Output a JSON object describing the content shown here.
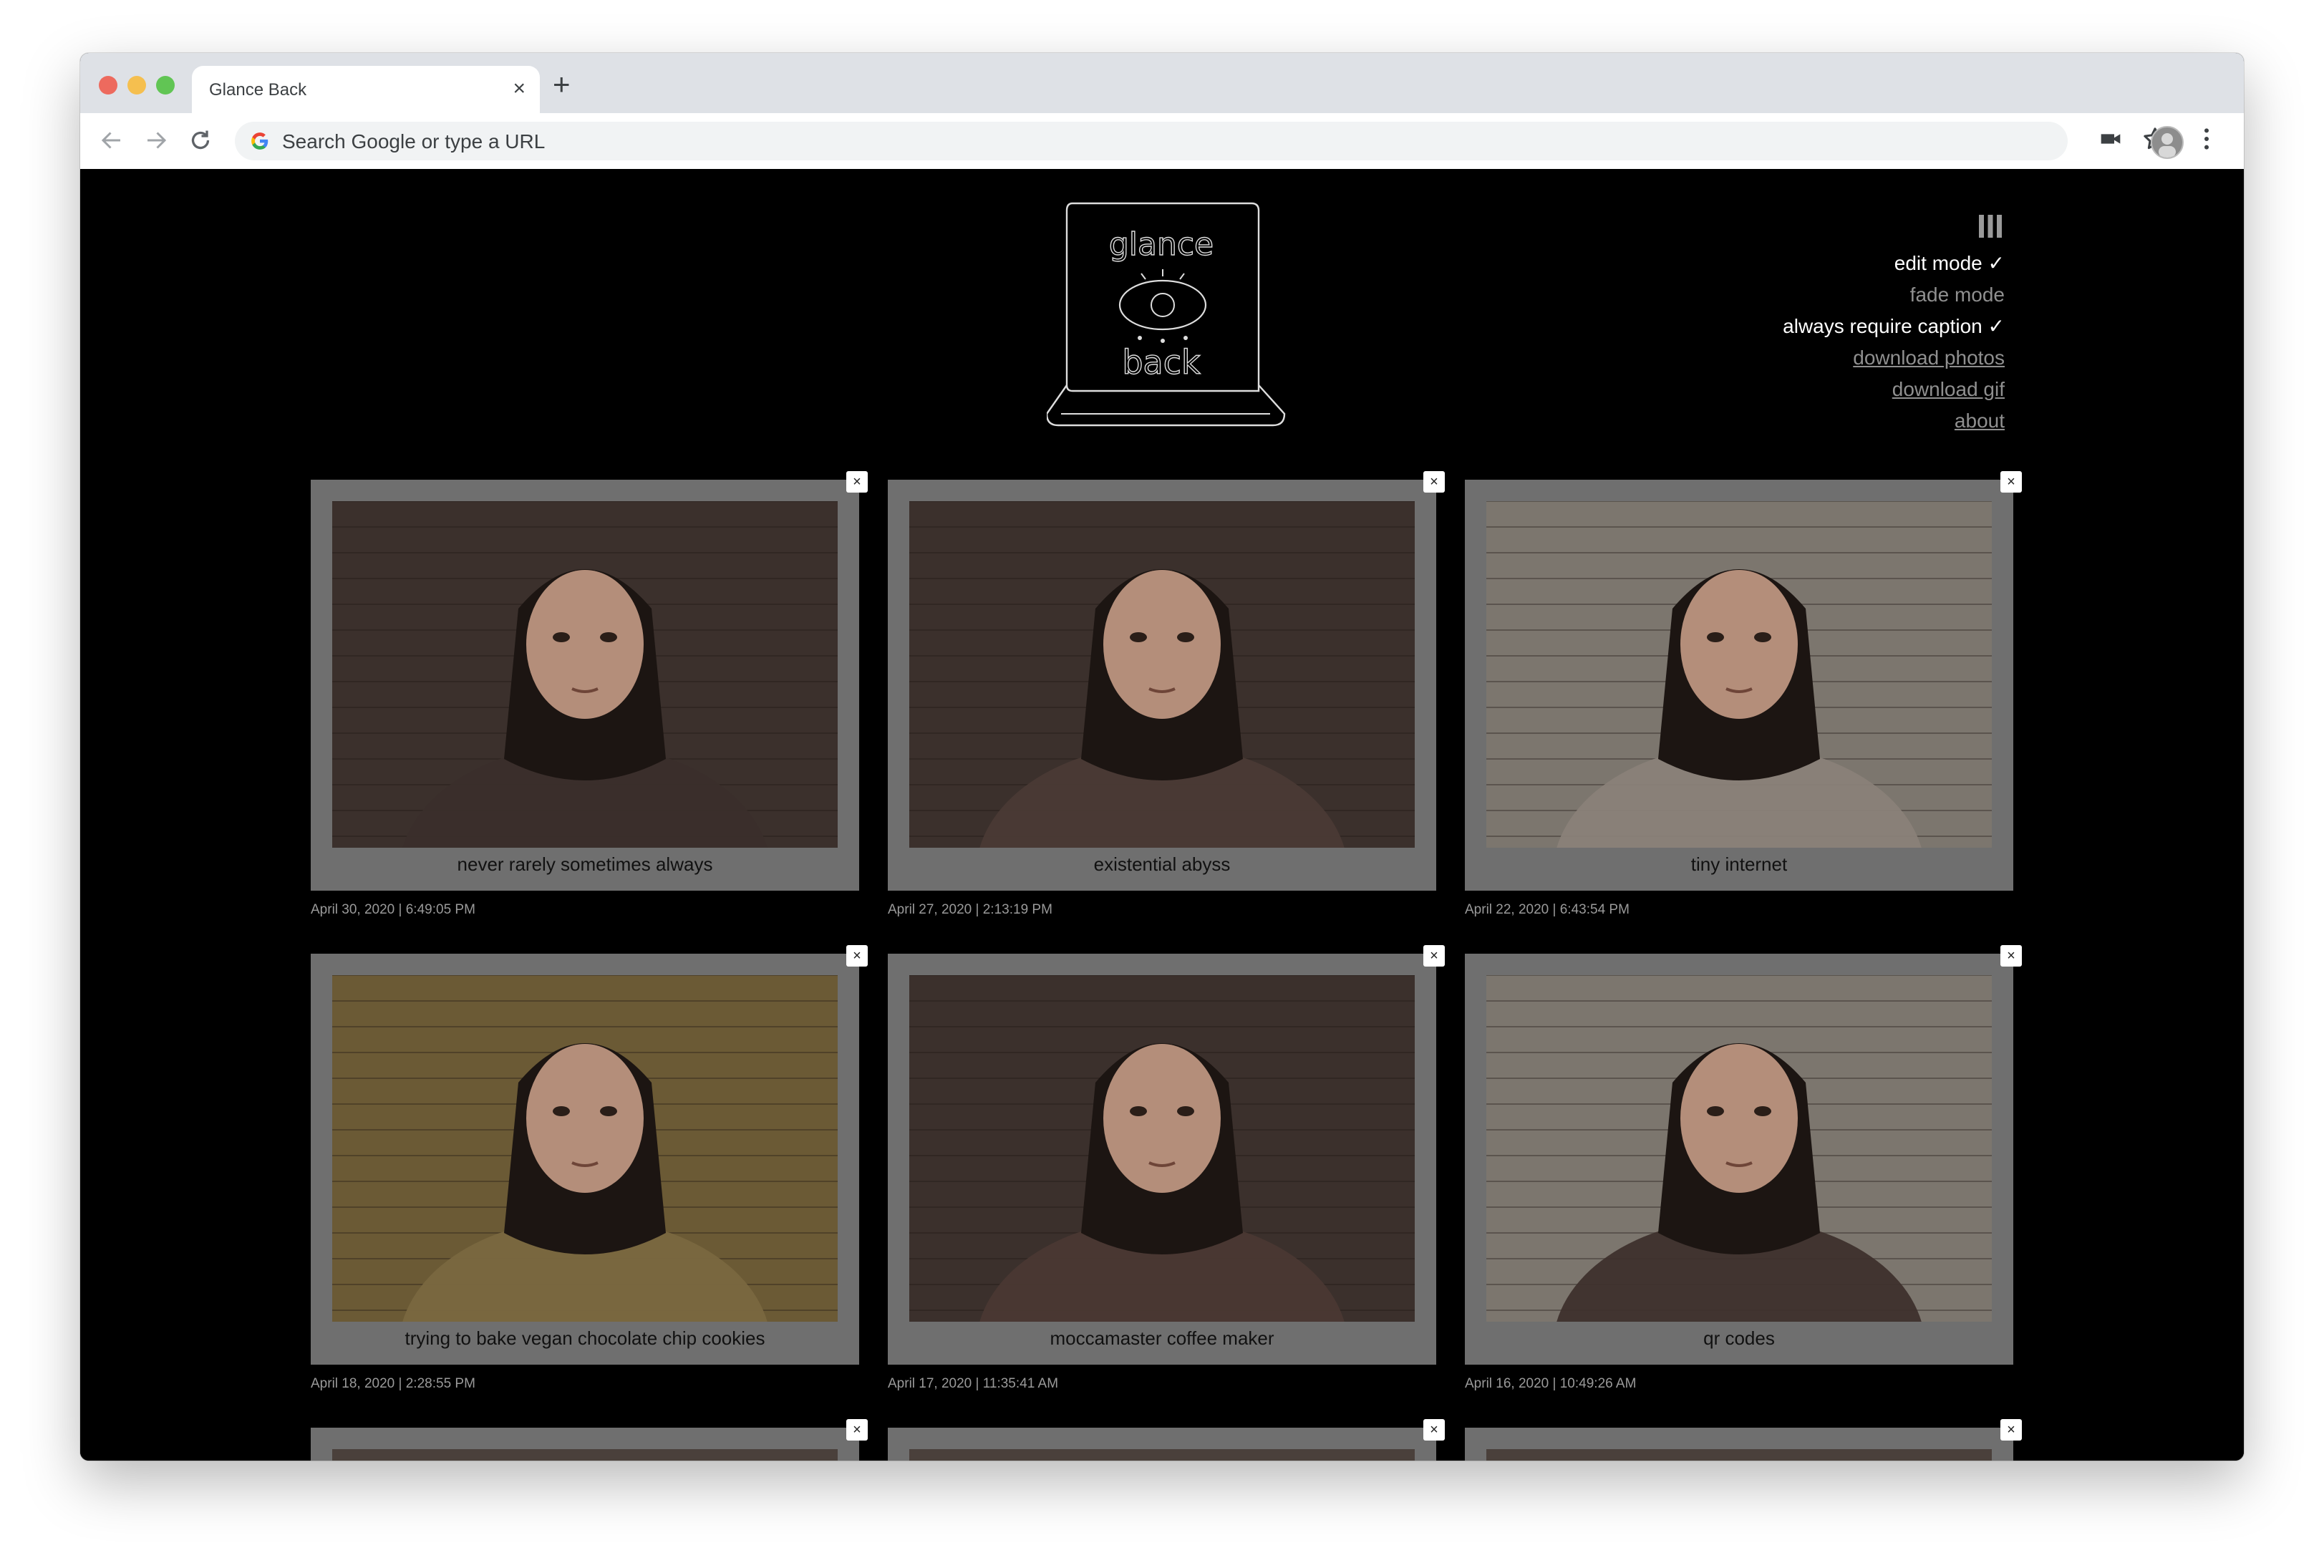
{
  "browser": {
    "tab_title": "Glance Back",
    "tab_close": "×",
    "new_tab": "+",
    "omnibox_placeholder": "Search Google or type a URL"
  },
  "menu": {
    "items": [
      {
        "label": "edit mode ✓",
        "state": "active"
      },
      {
        "label": "fade mode",
        "state": "inactive"
      },
      {
        "label": "always require caption ✓",
        "state": "active"
      },
      {
        "label": "download photos",
        "state": "link"
      },
      {
        "label": "download gif",
        "state": "link"
      },
      {
        "label": "about",
        "state": "link"
      }
    ]
  },
  "logo": {
    "top_text": "glance",
    "bottom_text": "back"
  },
  "photos": [
    {
      "caption": "never rarely sometimes always",
      "date": "April 30, 2020 | 6:49:05 PM",
      "tone": "#3a2e2b",
      "close": "×"
    },
    {
      "caption": "existential abyss",
      "date": "April 27, 2020 | 2:13:19 PM",
      "tone": "#4a3a35",
      "close": "×"
    },
    {
      "caption": "tiny internet",
      "date": "April 22, 2020 | 6:43:54 PM",
      "tone": "#8a8178",
      "close": "×"
    },
    {
      "caption": "trying to bake vegan chocolate chip cookies",
      "date": "April 18, 2020 | 2:28:55 PM",
      "tone": "#7a6840",
      "close": "×"
    },
    {
      "caption": "moccamaster coffee maker",
      "date": "April 17, 2020 | 11:35:41 AM",
      "tone": "#4a3833",
      "close": "×"
    },
    {
      "caption": "qr codes",
      "date": "April 16, 2020 | 10:49:26 AM",
      "tone": "#3e302c",
      "close": "×"
    }
  ],
  "partial_cards": [
    {
      "close": "×"
    },
    {
      "close": "×"
    },
    {
      "close": "×"
    }
  ]
}
